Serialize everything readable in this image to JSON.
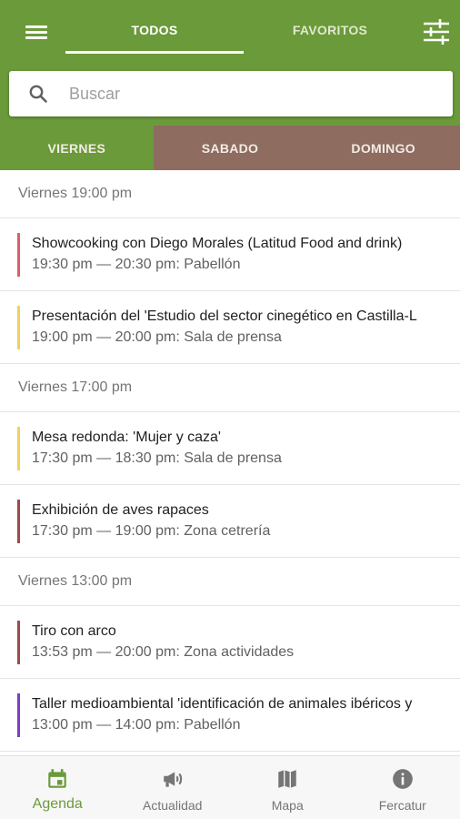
{
  "colors": {
    "primary": "#6b9a3a",
    "day_inactive": "#8e6c5f",
    "bar_red": "#d9606a",
    "bar_yellow": "#f2d15c",
    "bar_brown": "#9e4a4a",
    "bar_purple": "#7b3fbf"
  },
  "header": {
    "menu_icon": "hamburger-menu-icon",
    "tabs": [
      {
        "label": "TODOS",
        "selected": true
      },
      {
        "label": "FAVORITOS",
        "selected": false
      }
    ],
    "filter_icon": "sliders-filter-icon"
  },
  "search": {
    "placeholder": "Buscar",
    "value": "",
    "icon": "search-icon"
  },
  "days": [
    {
      "label": "VIERNES",
      "selected": true
    },
    {
      "label": "SABADO",
      "selected": false
    },
    {
      "label": "DOMINGO",
      "selected": false
    }
  ],
  "groups": [
    {
      "header": "Viernes 19:00 pm",
      "events": [
        {
          "title": "Showcooking con Diego Morales (Latitud Food and drink)",
          "time": "19:30 pm — 20:30 pm: Pabellón",
          "color": "#d9606a"
        },
        {
          "title": "Presentación del 'Estudio del sector cinegético en Castilla-L",
          "time": "19:00 pm — 20:00 pm: Sala de prensa",
          "color": "#f2d15c"
        }
      ]
    },
    {
      "header": "Viernes 17:00 pm",
      "events": [
        {
          "title": "Mesa redonda: 'Mujer y caza'",
          "time": "17:30 pm — 18:30 pm: Sala de prensa",
          "color": "#f2d15c"
        },
        {
          "title": "Exhibición de aves rapaces",
          "time": "17:30 pm — 19:00 pm: Zona cetrería",
          "color": "#9e4a4a"
        }
      ]
    },
    {
      "header": "Viernes 13:00 pm",
      "events": [
        {
          "title": "Tiro con arco",
          "time": "13:53 pm — 20:00 pm: Zona actividades",
          "color": "#9e4a4a"
        },
        {
          "title": "Taller medioambiental 'identificación de animales ibéricos y",
          "time": "13:00 pm — 14:00 pm: Pabellón",
          "color": "#7b3fbf"
        }
      ]
    }
  ],
  "bottom_nav": [
    {
      "label": "Agenda",
      "icon": "calendar-icon",
      "selected": true
    },
    {
      "label": "Actualidad",
      "icon": "megaphone-icon",
      "selected": false
    },
    {
      "label": "Mapa",
      "icon": "map-icon",
      "selected": false
    },
    {
      "label": "Fercatur",
      "icon": "info-icon",
      "selected": false
    }
  ]
}
